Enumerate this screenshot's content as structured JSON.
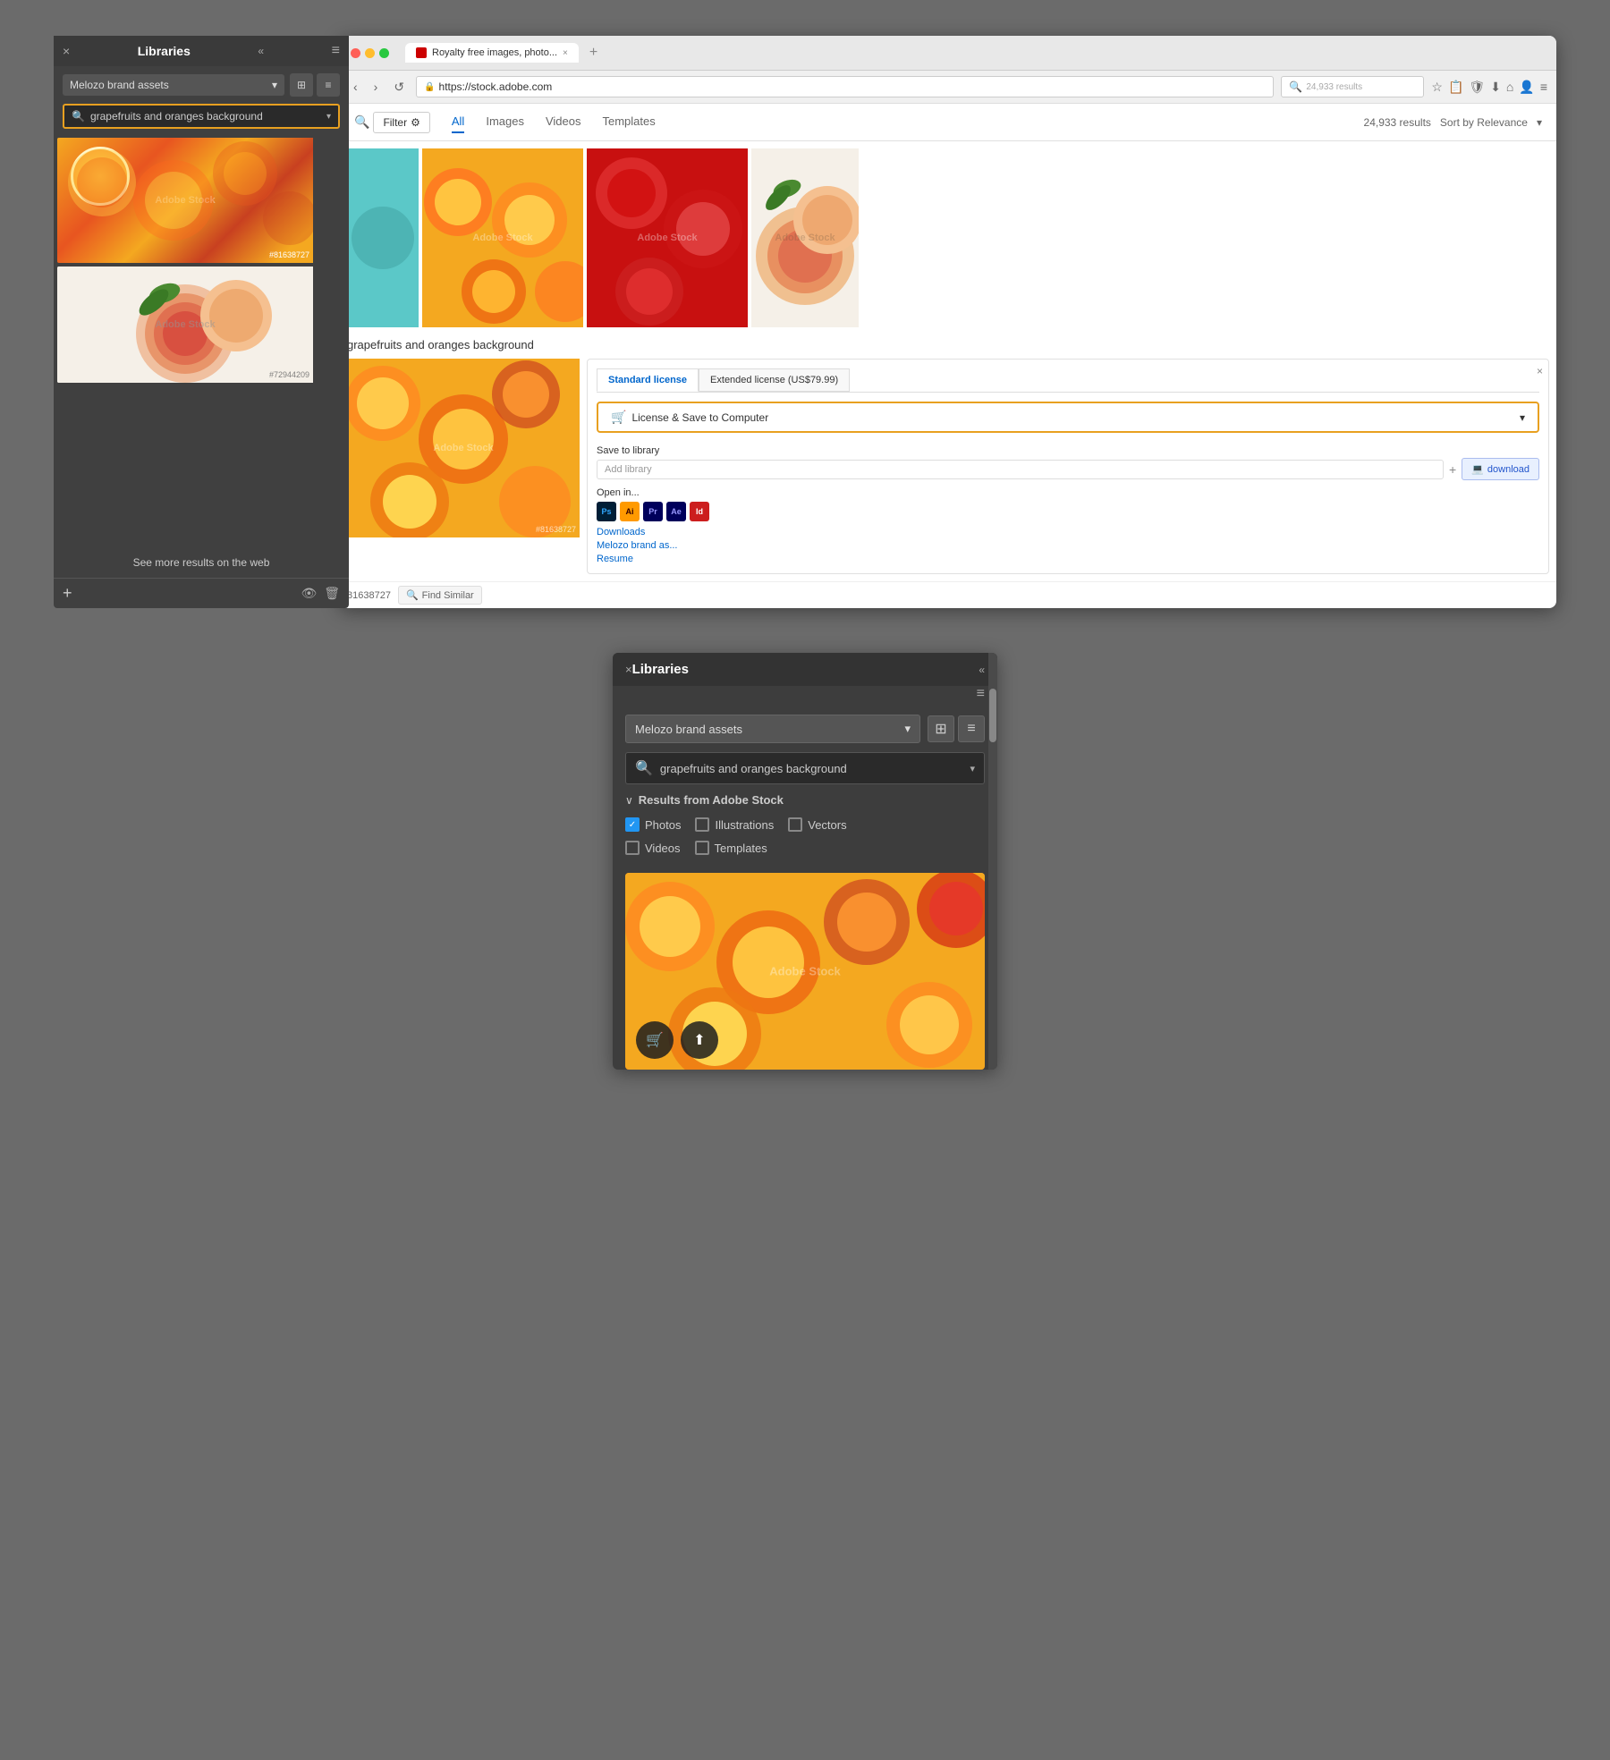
{
  "browser": {
    "tab_title": "Royalty free images, photo...",
    "tab_favicon": "AS",
    "url": "https://stock.adobe.com",
    "search_placeholder": "Search",
    "new_tab_icon": "+"
  },
  "stock": {
    "filter_label": "Filter",
    "tabs": [
      "All",
      "Images",
      "Videos",
      "Templates"
    ],
    "active_tab": "All",
    "results_count": "24,933 results",
    "sort_label": "Sort by Relevance",
    "image_title": "grapefruits and oranges background",
    "standard_license": "Standard license",
    "extended_license": "Extended license (US$79.99)",
    "license_save_btn": "License & Save to  Computer",
    "save_to_library": "Save to library",
    "add_library_placeholder": "Add library",
    "download_btn": "download",
    "open_in_label": "Open in...",
    "downloads_link": "Downloads",
    "melozo_link": "Melozo brand as...",
    "resume_link": "Resume",
    "image_id_large": "#81638727",
    "image_id_bottom": "81638727",
    "find_similar_btn": "Find Similar"
  },
  "library_top": {
    "close_icon": "×",
    "collapse_icon": "«",
    "title": "Libraries",
    "menu_icon": "≡",
    "dropdown_value": "Melozo brand assets",
    "search_query": "grapefruits and oranges background",
    "image_id_1": "#81638727",
    "image_id_2": "#72944209",
    "see_more_web": "See more results on the web",
    "add_icon": "+",
    "eye_icon": "👁",
    "delete_icon": "🗑"
  },
  "library_bottom": {
    "close_icon": "×",
    "collapse_icon": "«",
    "title": "Libraries",
    "menu_icon": "≡",
    "dropdown_value": "Melozo brand assets",
    "search_query": "grapefruits and oranges background",
    "results_header": "Results from Adobe Stock",
    "filter_photos": "Photos",
    "filter_illustrations": "Illustrations",
    "filter_vectors": "Vectors",
    "filter_videos": "Videos",
    "filter_templates": "Templates",
    "photos_checked": true,
    "illustrations_checked": false,
    "vectors_checked": false,
    "videos_checked": false,
    "templates_checked": false,
    "watermark": "Adobe Stock",
    "cart_icon": "🛒",
    "upload_icon": "⬆"
  },
  "app_icons": {
    "ps": "Ps",
    "ai": "Ai",
    "pr": "Pr",
    "ae": "Ae",
    "id": "Id"
  }
}
